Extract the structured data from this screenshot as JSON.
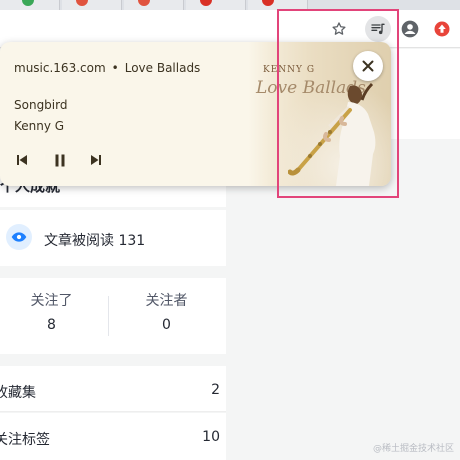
{
  "toolbar": {
    "icons": [
      "star-icon",
      "media-control-icon",
      "account-icon",
      "extension-icon"
    ]
  },
  "media_popup": {
    "source": "music.163.com",
    "separator": "•",
    "album": "Love Ballads",
    "track_title": "Songbird",
    "artist": "Kenny G",
    "album_art": {
      "artist_text": "KENNY G",
      "album_text": "Love Ballads"
    }
  },
  "profile_page": {
    "partial_heading": "个人成就",
    "views": {
      "text": "文章被阅读 131"
    },
    "follow_stats": {
      "following_label": "关注了",
      "following_count": "8",
      "followers_label": "关注者",
      "followers_count": "0"
    },
    "collections": {
      "label": "收藏集",
      "count": "2"
    },
    "tags": {
      "label": "关注标签",
      "count": "10"
    }
  },
  "watermark": "@稀土掘金技术社区",
  "colors": {
    "highlight": "#e2447a",
    "popup_bg": "#faf6ea",
    "eye_blue": "#1e80ff"
  }
}
